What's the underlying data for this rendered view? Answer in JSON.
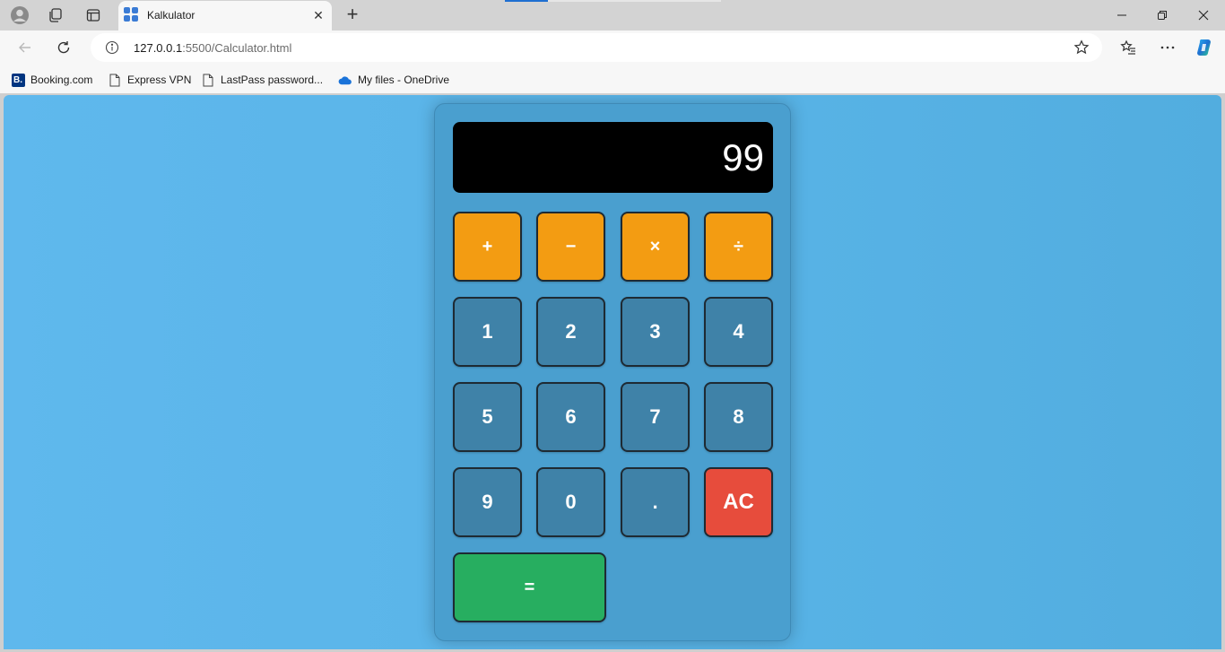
{
  "browser": {
    "tab_title": "Kalkulator",
    "url_host": "127.0.0.1",
    "url_rest": ":5500/Calculator.html",
    "bookmarks": [
      {
        "label": "Booking.com",
        "icon": "booking-logo"
      },
      {
        "label": "Express VPN",
        "icon": "page-icon"
      },
      {
        "label": "LastPass password...",
        "icon": "page-icon"
      },
      {
        "label": "My files - OneDrive",
        "icon": "onedrive-icon"
      }
    ]
  },
  "calculator": {
    "display": "99",
    "operators": [
      "+",
      "−",
      "×",
      "÷"
    ],
    "digits_row1": [
      "1",
      "2",
      "3",
      "4"
    ],
    "digits_row2": [
      "5",
      "6",
      "7",
      "8"
    ],
    "row4": [
      "9",
      "0",
      "."
    ],
    "clear_label": "AC",
    "equal_label": "=",
    "colors": {
      "page_bg": "#5fb8ed",
      "body": "#4a9fcf",
      "operator": "#f39c12",
      "number": "#3f82a8",
      "clear": "#e74c3c",
      "equal": "#27ae60",
      "display": "#000000"
    }
  }
}
